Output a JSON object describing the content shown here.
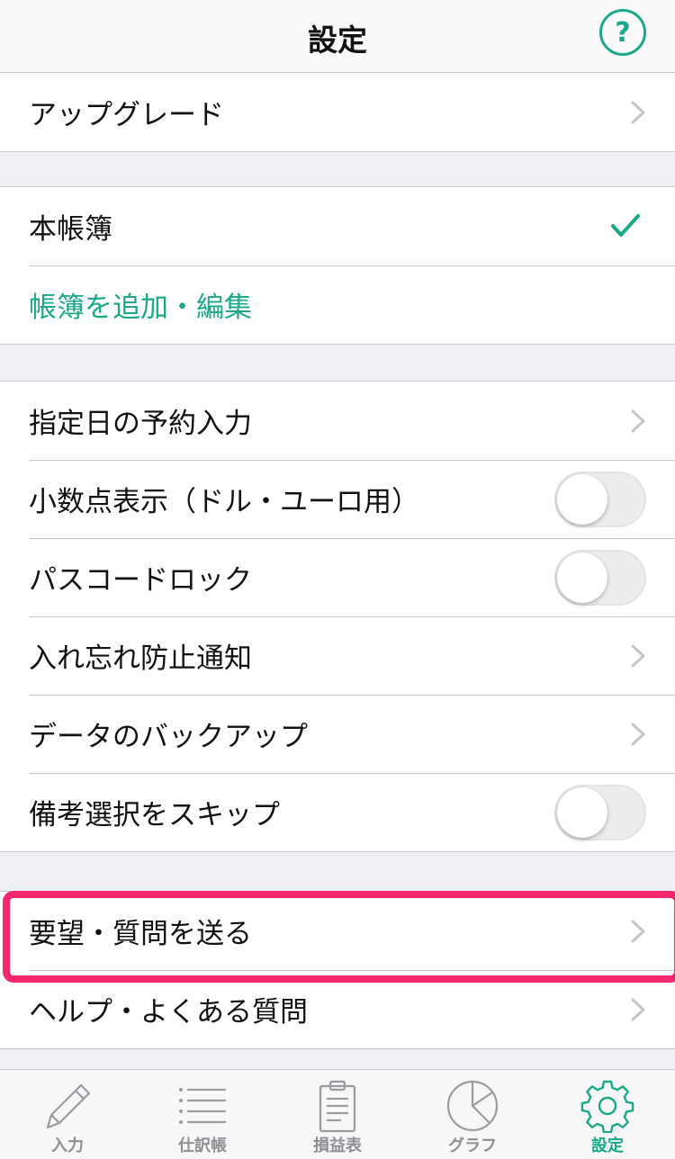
{
  "navbar": {
    "title": "設定",
    "help_label": "?"
  },
  "sections": {
    "upgrade": {
      "label": "アップグレード"
    },
    "ledger": {
      "current": "本帳簿",
      "add_edit": "帳簿を追加・編集"
    },
    "options": {
      "scheduled_input": "指定日の予約入力",
      "decimal_display": "小数点表示（ドル・ユーロ用）",
      "passcode_lock": "パスコードロック",
      "reminder": "入れ忘れ防止通知",
      "backup": "データのバックアップ",
      "skip_memo": "備考選択をスキップ"
    },
    "support": {
      "feedback": "要望・質問を送る",
      "help_faq": "ヘルプ・よくある質問"
    }
  },
  "toggles": {
    "decimal_display": false,
    "passcode_lock": false,
    "skip_memo": false
  },
  "tabbar": {
    "tabs": [
      {
        "label": "入力",
        "icon": "pencil-icon"
      },
      {
        "label": "仕訳帳",
        "icon": "list-icon"
      },
      {
        "label": "損益表",
        "icon": "clipboard-icon"
      },
      {
        "label": "グラフ",
        "icon": "pie-chart-icon"
      },
      {
        "label": "設定",
        "icon": "gear-icon"
      }
    ],
    "active": "設定"
  },
  "colors": {
    "accent": "#1aa888",
    "highlight": "#f5286e",
    "background": "#efeff4"
  }
}
